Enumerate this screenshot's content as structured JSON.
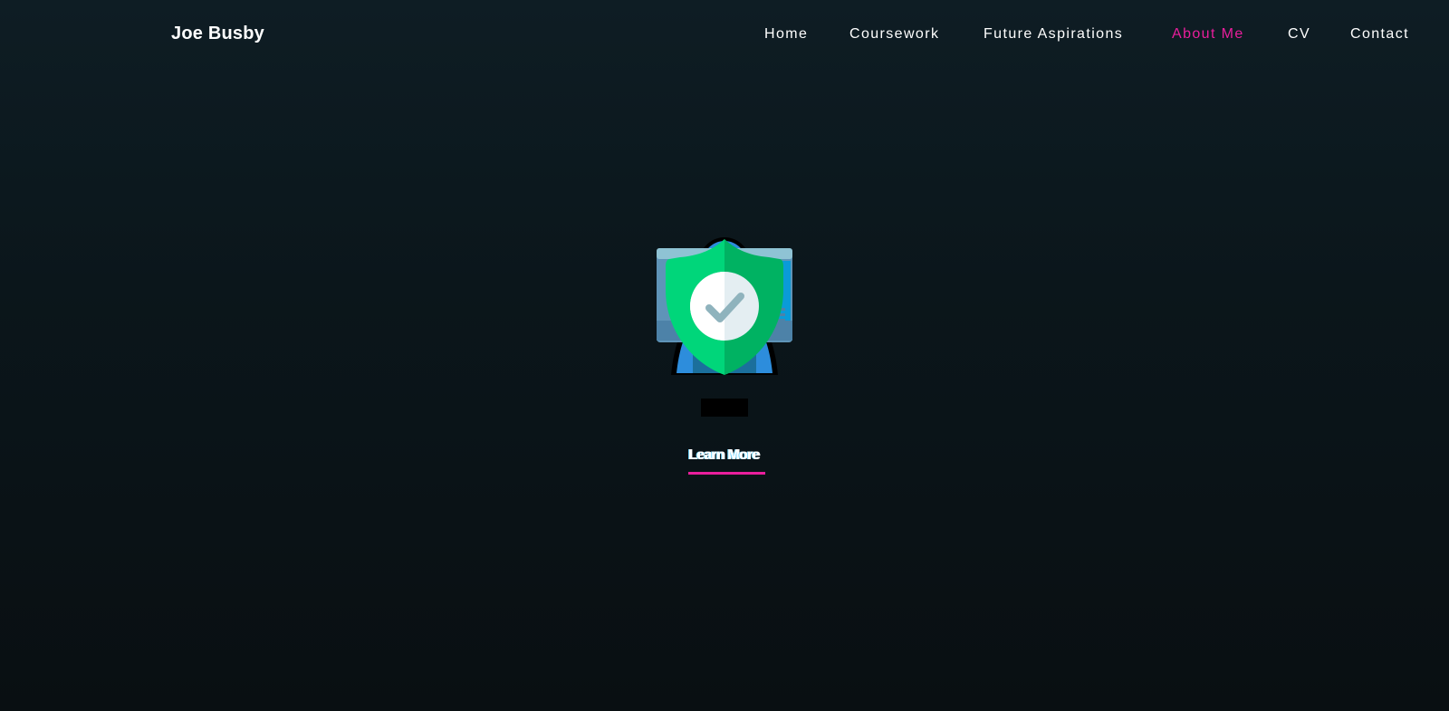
{
  "brand": {
    "name": "Joe Busby"
  },
  "nav": {
    "items": [
      {
        "label": "Home",
        "active": false
      },
      {
        "label": "Coursework",
        "active": false
      },
      {
        "label": "Future Aspirations",
        "active": false
      },
      {
        "label": "About Me",
        "active": true
      },
      {
        "label": "CV",
        "active": false
      },
      {
        "label": "Contact",
        "active": false
      }
    ]
  },
  "hero": {
    "icon": "security-shield-check-icon",
    "label": "",
    "cta_label": "Learn More"
  },
  "colors": {
    "accent": "#e91e9c",
    "shield_light": "#00d67a",
    "shield_dark": "#00b262",
    "text": "#ffffff"
  }
}
